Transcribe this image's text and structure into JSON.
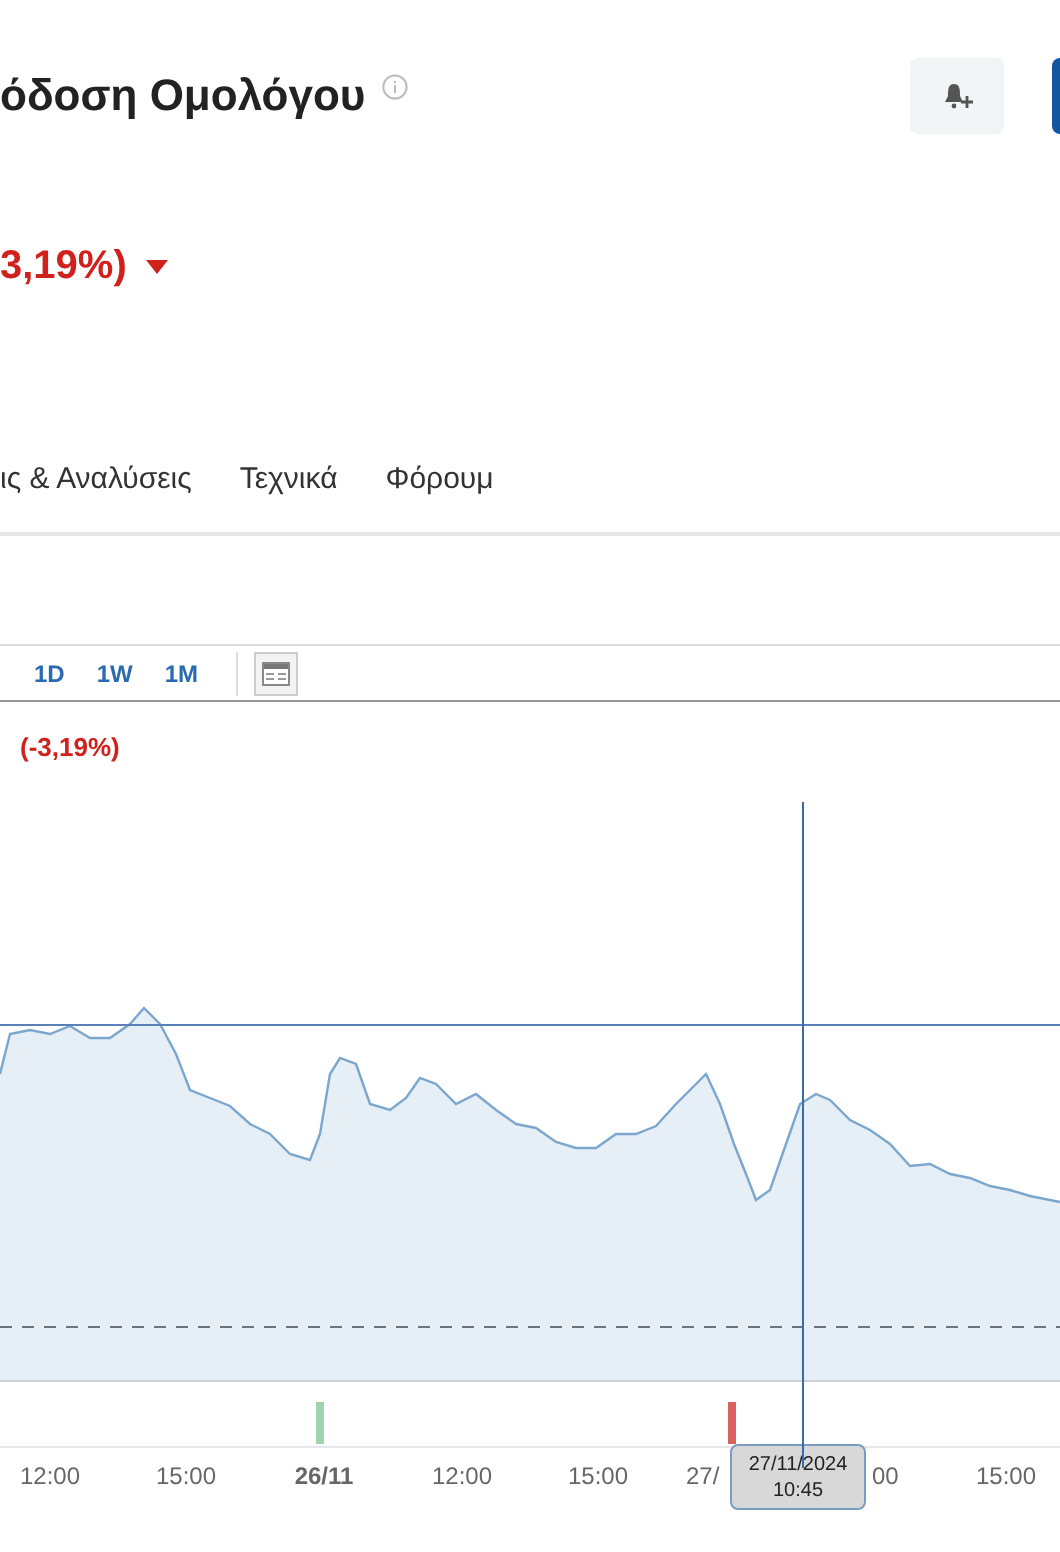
{
  "header": {
    "title": "όδοση Ομολόγου",
    "change": "3,19%)"
  },
  "tabs": [
    {
      "label": "ις & Αναλύσεις",
      "selected": false
    },
    {
      "label": "Τεχνικά",
      "selected": false
    },
    {
      "label": "Φόρουμ",
      "selected": false
    }
  ],
  "ranges": [
    {
      "label": "1D",
      "selected": false
    },
    {
      "label": "1W",
      "selected": false
    },
    {
      "label": "1M",
      "selected": false
    }
  ],
  "chart": {
    "change": "(-3,19%)",
    "x_labels": [
      {
        "label": "12:00",
        "bold": false
      },
      {
        "label": "15:00",
        "bold": false
      },
      {
        "label": "26/11",
        "bold": true
      },
      {
        "label": "12:00",
        "bold": false
      },
      {
        "label": "15:00",
        "bold": false
      },
      {
        "label": "27/",
        "bold": false
      },
      {
        "label": "00",
        "bold": false
      },
      {
        "label": "15:00",
        "bold": false
      }
    ],
    "volume_bars": [
      {
        "color": "#9fd4ae"
      },
      {
        "color": "#d9625e"
      }
    ],
    "tooltip": {
      "date": "27/11/2024",
      "time": "10:45"
    }
  }
}
